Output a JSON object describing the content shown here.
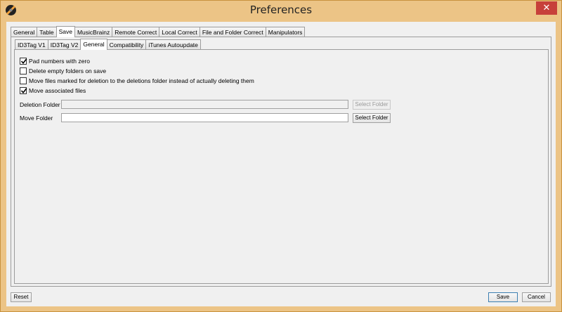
{
  "window": {
    "title": "Preferences",
    "close_glyph": "✕"
  },
  "main_tabs": [
    "General",
    "Table",
    "Save",
    "MusicBrainz",
    "Remote Correct",
    "Local Correct",
    "File and Folder Correct",
    "Manipulators"
  ],
  "sub_tabs": [
    "ID3Tag V1",
    "ID3Tag V2",
    "General",
    "Compatibility",
    "iTunes Autoupdate"
  ],
  "options": [
    {
      "label": "Pad numbers with zero",
      "checked": true
    },
    {
      "label": "Delete empty folders on save",
      "checked": false
    },
    {
      "label": "Move files marked for deletion to the deletions folder instead of actually deleting them",
      "checked": false
    },
    {
      "label": "Move associated files",
      "checked": true
    }
  ],
  "deletion_folder": {
    "label": "Deletion Folder",
    "value": "",
    "button": "Select Folder"
  },
  "move_folder": {
    "label": "Move Folder",
    "value": "",
    "button": "Select Folder"
  },
  "footer": {
    "reset": "Reset",
    "save": "Save",
    "cancel": "Cancel"
  }
}
